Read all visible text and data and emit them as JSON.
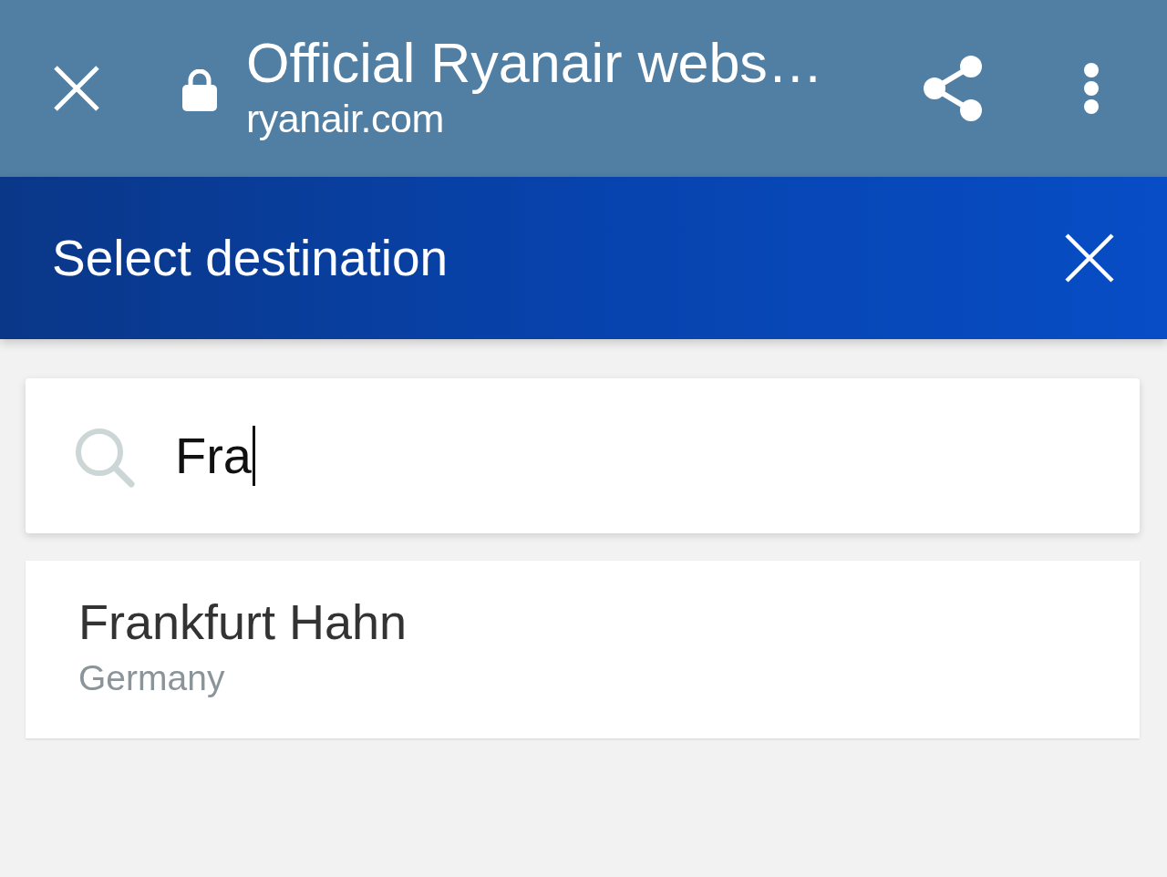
{
  "browser_bar": {
    "title": "Official Ryanair webs…",
    "url": "ryanair.com"
  },
  "header": {
    "title": "Select destination"
  },
  "search": {
    "value": "Fra",
    "focused": true
  },
  "results": [
    {
      "name": "Frankfurt Hahn",
      "country": "Germany"
    }
  ]
}
